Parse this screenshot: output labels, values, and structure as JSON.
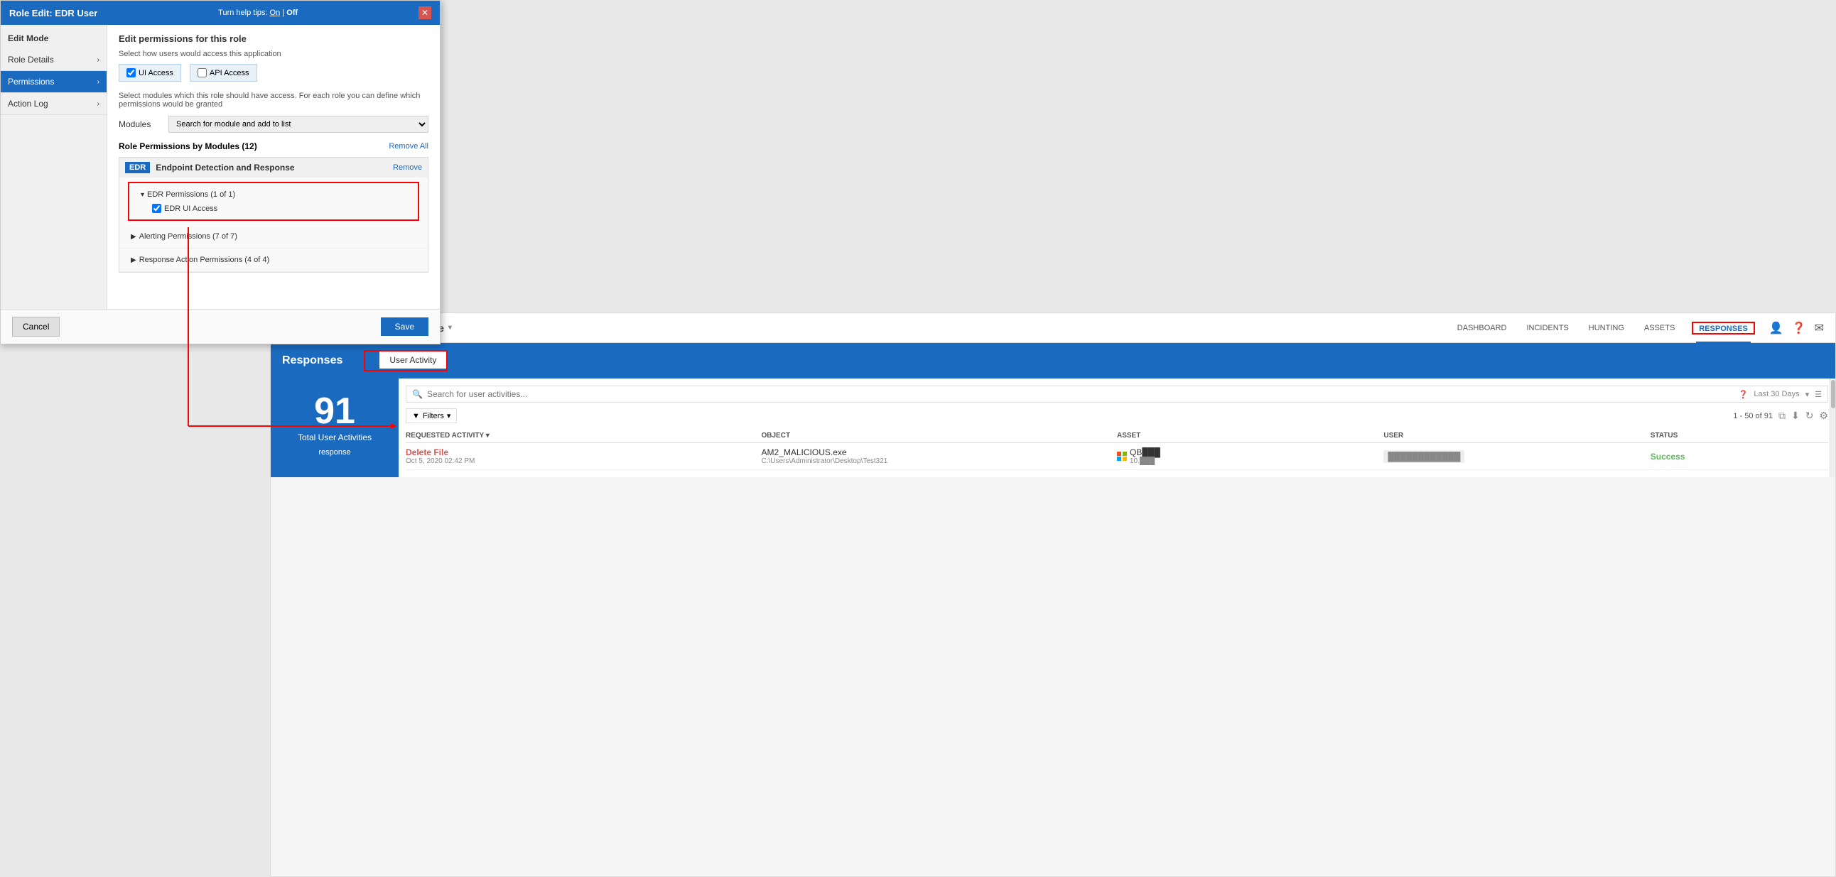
{
  "modal": {
    "title": "Role Edit: EDR User",
    "helpTips": "Turn help tips:",
    "helpOn": "On",
    "helpSep": "|",
    "helpOff": "Off",
    "sidebar": {
      "editMode": "Edit Mode",
      "items": [
        {
          "label": "Role Details",
          "active": false
        },
        {
          "label": "Permissions",
          "active": true
        },
        {
          "label": "Action Log",
          "active": false
        }
      ]
    },
    "content": {
      "heading": "Edit permissions for this role",
      "subLabel": "Select how users would access this application",
      "uiAccessLabel": "UI Access",
      "apiAccessLabel": "API Access",
      "modulesSubLabel": "Select modules which this role should have access. For each role you can define which permissions would be granted",
      "modulesLabel": "Modules",
      "modulesPlaceholder": "Search for module and add to list",
      "rolePermissionsLabel": "Role Permissions by Modules (12)",
      "removeAll": "Remove All",
      "remove": "Remove",
      "edrBadge": "EDR",
      "edrModuleName": "Endpoint Detection and Response",
      "permissions": [
        {
          "label": "EDR Permissions (1 of 1)",
          "expanded": true,
          "items": [
            {
              "label": "EDR UI Access",
              "checked": true
            }
          ],
          "highlighted": true
        },
        {
          "label": "Alerting Permissions (7 of 7)",
          "expanded": false,
          "items": []
        },
        {
          "label": "Response Action Permissions (4 of 4)",
          "expanded": false,
          "items": []
        }
      ]
    },
    "cancelLabel": "Cancel",
    "saveLabel": "Save"
  },
  "edr": {
    "brand": "Endpoint Detection and Response",
    "brandDropdown": "▾",
    "navTabs": [
      {
        "label": "DASHBOARD",
        "active": false
      },
      {
        "label": "INCIDENTS",
        "active": false
      },
      {
        "label": "HUNTING",
        "active": false
      },
      {
        "label": "ASSETS",
        "active": false
      },
      {
        "label": "RESPONSES",
        "active": true
      }
    ],
    "responsesTitle": "Responses",
    "userActivityTab": "User Activity",
    "leftPanel": {
      "bigNumber": "91",
      "subtitle": "Total User Activities",
      "subLabel": "response"
    },
    "searchPlaceholder": "Search for user activities...",
    "lastDays": "Last 30 Days",
    "filtersLabel": "Filters",
    "pagination": "1 - 50 of 91",
    "tableHeaders": [
      "REQUESTED ACTIVITY",
      "OBJECT",
      "ASSET",
      "USER",
      "STATUS"
    ],
    "tableRows": [
      {
        "activityName": "Delete File",
        "activityDate": "Oct 5, 2020 02:42 PM",
        "objectName": "AM2_MALICIOUS.exe",
        "objectPath": "C:\\Users\\Administrator\\Desktop\\Test321",
        "asset": "QB███",
        "assetSub": "10.███",
        "user": "████████████",
        "status": "Success"
      }
    ]
  }
}
